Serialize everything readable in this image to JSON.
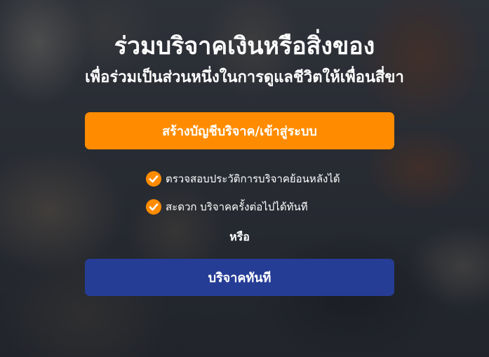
{
  "hero": {
    "title": "ร่วมบริจาคเงินหรือสิ่งของ",
    "subtitle": "เพื่อร่วมเป็นส่วนหนึ่งในการดูแลชีวิตให้เพื่อนสี่ขา"
  },
  "actions": {
    "login_label": "สร้างบัญชีบริจาค/เข้าสู่ระบบ",
    "or_label": "หรือ",
    "donate_now_label": "บริจาคทันที"
  },
  "features": [
    {
      "icon": "check-circle-icon",
      "text": "ตรวจสอบประวัติการบริจาคย้อนหลังได้"
    },
    {
      "icon": "check-circle-icon",
      "text": "สะดวก บริจาคครั้งต่อไปได้ทันที"
    }
  ],
  "colors": {
    "primary_orange": "#ff8c00",
    "primary_blue": "#263d96",
    "text": "#ffffff"
  }
}
